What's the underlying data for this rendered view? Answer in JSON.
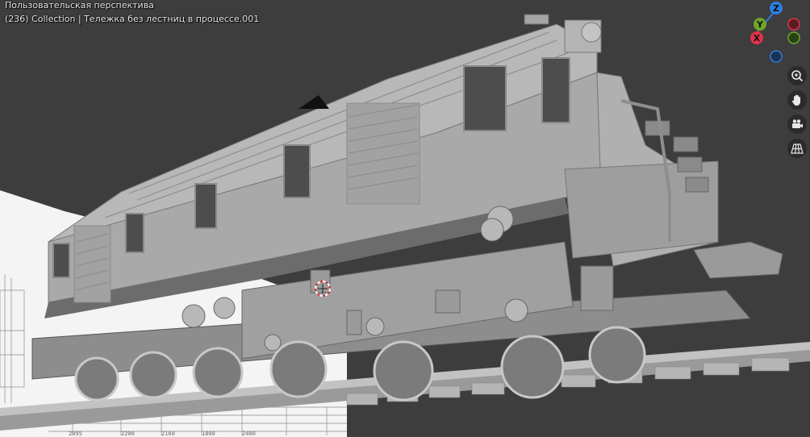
{
  "viewport": {
    "view_name": "Пользовательская перспектива",
    "collection_info": "(236) Collection | Тележка без лестниц в процессе.001"
  },
  "gizmo": {
    "axes": [
      {
        "label": "Z",
        "color": "#2f7de1"
      },
      {
        "label": "Y",
        "color": "#6ea52b"
      },
      {
        "label": "X",
        "color": "#e0334a"
      }
    ]
  },
  "navigation": [
    {
      "name": "zoom-icon",
      "title": "Zoom"
    },
    {
      "name": "hand-icon",
      "title": "Pan"
    },
    {
      "name": "camera-icon",
      "title": "Camera"
    },
    {
      "name": "grid-icon",
      "title": "Orthographic"
    }
  ],
  "blueprint": {
    "dimensions": [
      "2095",
      "2200",
      "2160",
      "1800",
      "2400"
    ]
  }
}
